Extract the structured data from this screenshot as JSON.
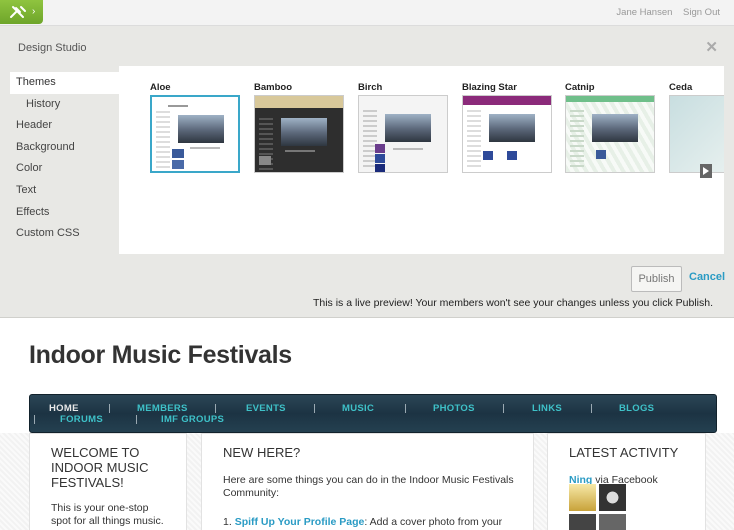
{
  "topbar": {
    "tools_icon": "tools-icon",
    "user_name": "Jane Hansen",
    "sign_out": "Sign Out"
  },
  "studio": {
    "title": "Design Studio",
    "close_icon": "close-icon",
    "tabs": [
      {
        "label": "Themes",
        "active": true
      },
      {
        "label": "History",
        "sub": true
      },
      {
        "label": "Header"
      },
      {
        "label": "Background"
      },
      {
        "label": "Color"
      },
      {
        "label": "Text"
      },
      {
        "label": "Effects"
      },
      {
        "label": "Custom CSS"
      }
    ],
    "themes": [
      {
        "name": "Aloe",
        "selected": true
      },
      {
        "name": "Bamboo"
      },
      {
        "name": "Birch"
      },
      {
        "name": "Blazing Star"
      },
      {
        "name": "Catnip"
      },
      {
        "name": "Ceda"
      }
    ],
    "next_icon": "arrow-right-icon",
    "publish_label": "Publish",
    "cancel_label": "Cancel",
    "preview_note": "This is a live preview! Your members won't see your changes unless you click Publish."
  },
  "site": {
    "title": "Indoor Music Festivals",
    "nav": [
      "HOME",
      "MEMBERS",
      "EVENTS",
      "MUSIC",
      "PHOTOS",
      "LINKS",
      "BLOGS",
      "FORUMS",
      "IMF GROUPS"
    ],
    "welcome": {
      "heading_1": "WELCOME TO",
      "heading_2": "INDOOR MUSIC",
      "heading_3": "FESTIVALS!",
      "body_1": "This is your one-stop",
      "body_2": "spot for all things music."
    },
    "newhere": {
      "heading": "NEW HERE?",
      "body_1": "Here are some things you can do in the Indoor Music Festivals",
      "body_2": "Community:",
      "item_num": "1.",
      "item_link": "Spiff Up Your Profile Page",
      "item_text": ": Add a cover photo from your"
    },
    "activity": {
      "heading": "LATEST ACTIVITY",
      "source_link": "Ning",
      "source_text": " via Facebook"
    }
  },
  "colors": {
    "accent": "#2a9bc4",
    "nav_text": "#3ec1c8",
    "tools_green": "#7ab233",
    "selected_border": "#3aa7c9"
  }
}
